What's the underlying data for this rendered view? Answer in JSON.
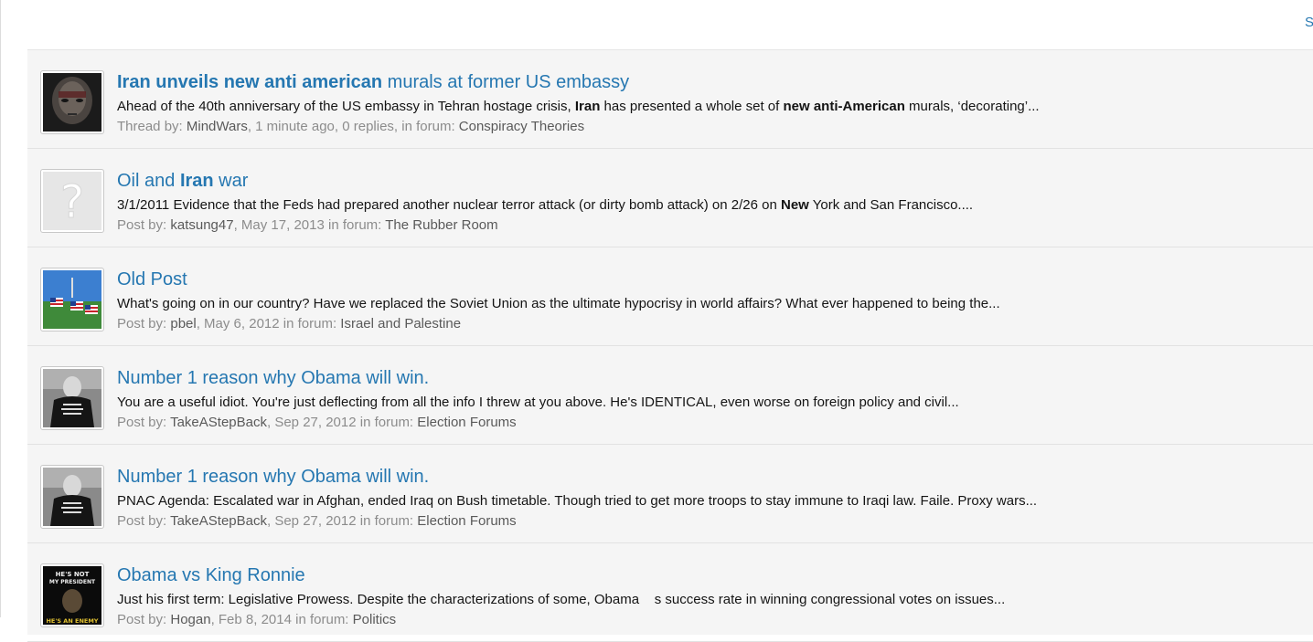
{
  "corner_link": "S",
  "results": [
    {
      "title": [
        [
          "Iran unveils new anti american",
          true
        ],
        [
          " murals at former US embassy",
          false
        ]
      ],
      "snippet": [
        [
          "Ahead of the 40th anniversary of the US embassy in Tehran hostage crisis, ",
          false
        ],
        [
          "Iran",
          true
        ],
        [
          " has presented a whole set of ",
          false
        ],
        [
          "new anti-American",
          true
        ],
        [
          " murals, ‘decorating’...",
          false
        ]
      ],
      "meta": {
        "kind": "Thread by: ",
        "author": "MindWars",
        "when": ", 1 minute ago, 0 replies, in forum: ",
        "forum": "Conspiracy Theories"
      },
      "avatar": "dark-face-avatar"
    },
    {
      "title": [
        [
          "Oil and ",
          false
        ],
        [
          "Iran",
          true
        ],
        [
          " war",
          false
        ]
      ],
      "snippet": [
        [
          "3/1/2011 Evidence that the Feds had prepared another nuclear terror attack (or dirty bomb attack) on 2/26 on ",
          false
        ],
        [
          "New",
          true
        ],
        [
          " York and San Francisco....",
          false
        ]
      ],
      "meta": {
        "kind": "Post by: ",
        "author": "katsung47",
        "when": ", May 17, 2013 in forum: ",
        "forum": "The Rubber Room"
      },
      "avatar": "question-mark-avatar"
    },
    {
      "title": [
        [
          "Old Post",
          false
        ]
      ],
      "snippet": [
        [
          "What's going on in our country? Have we replaced the Soviet Union as the ultimate hypocrisy in world affairs? What ever happened to being the...",
          false
        ]
      ],
      "meta": {
        "kind": "Post by: ",
        "author": "pbel",
        "when": ", May 6, 2012 in forum: ",
        "forum": "Israel and Palestine"
      },
      "avatar": "flags-avatar"
    },
    {
      "title": [
        [
          "Number 1 reason why Obama will win.",
          false
        ]
      ],
      "snippet": [
        [
          "You are a useful idiot. You're just deflecting from all the info I threw at you above. He's IDENTICAL, even worse on foreign policy and civil...",
          false
        ]
      ],
      "meta": {
        "kind": "Post by: ",
        "author": "TakeAStepBack",
        "when": ", Sep 27, 2012 in forum: ",
        "forum": "Election Forums"
      },
      "avatar": "old-man-avatar"
    },
    {
      "title": [
        [
          "Number 1 reason why Obama will win.",
          false
        ]
      ],
      "snippet": [
        [
          "PNAC Agenda: Escalated war in Afghan, ended Iraq on Bush timetable. Though tried to get more troops to stay immune to Iraqi law. Faile. Proxy wars...",
          false
        ]
      ],
      "meta": {
        "kind": "Post by: ",
        "author": "TakeAStepBack",
        "when": ", Sep 27, 2012 in forum: ",
        "forum": "Election Forums"
      },
      "avatar": "old-man-avatar"
    },
    {
      "title": [
        [
          "Obama vs King Ronnie",
          false
        ]
      ],
      "snippet": [
        [
          "Just his first term: Legislative Prowess. Despite the characterizations of some, Obama    s success rate in winning congressional votes on issues...",
          false
        ]
      ],
      "meta": {
        "kind": "Post by: ",
        "author": "Hogan",
        "when": ", Feb 8, 2014 in forum: ",
        "forum": "Politics"
      },
      "avatar": "poster-avatar",
      "avatar_text": [
        "HE'S NOT",
        "MY PRESIDENT",
        "HE'S AN ENEMY"
      ]
    }
  ]
}
